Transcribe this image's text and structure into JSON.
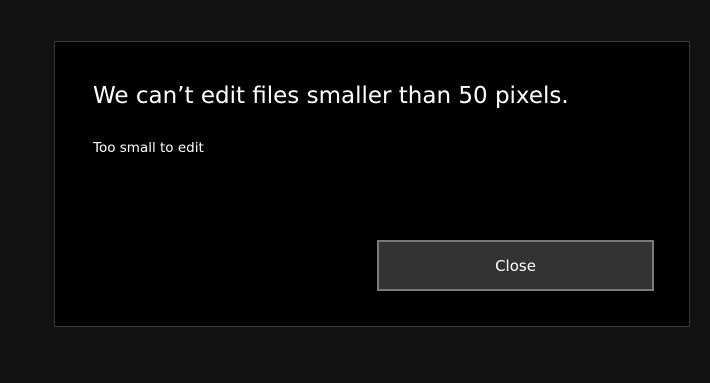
{
  "dialog": {
    "title": "We can’t edit files smaller than 50 pixels.",
    "message": "Too small to edit",
    "close_label": "Close"
  }
}
